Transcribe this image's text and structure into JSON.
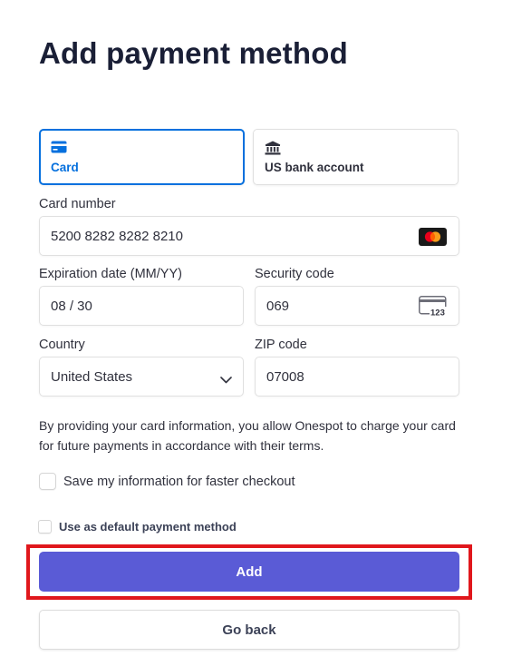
{
  "page": {
    "title": "Add payment method"
  },
  "tabs": [
    {
      "label": "Card",
      "icon": "credit-card-icon",
      "selected": true
    },
    {
      "label": "US bank account",
      "icon": "bank-icon",
      "selected": false
    }
  ],
  "form": {
    "card_number": {
      "label": "Card number",
      "value": "5200 8282 8282 8210",
      "brand_icon": "mastercard-icon"
    },
    "expiration": {
      "label": "Expiration date (MM/YY)",
      "value": "08 / 30"
    },
    "security_code": {
      "label": "Security code",
      "value": "069",
      "icon": "cvc-card-icon",
      "icon_text": "123"
    },
    "country": {
      "label": "Country",
      "value": "United States"
    },
    "zip": {
      "label": "ZIP code",
      "value": "07008"
    }
  },
  "notice": "By providing your card information, you allow Onespot to charge your card for future payments in accordance with their terms.",
  "save_info": {
    "label": "Save my information for faster checkout",
    "checked": false
  },
  "default_method": {
    "label": "Use as default payment method",
    "checked": false
  },
  "buttons": {
    "add": "Add",
    "back": "Go back"
  },
  "colors": {
    "accent": "#0570de",
    "primary_button": "#5a5bd6",
    "highlight": "#e0171c"
  }
}
